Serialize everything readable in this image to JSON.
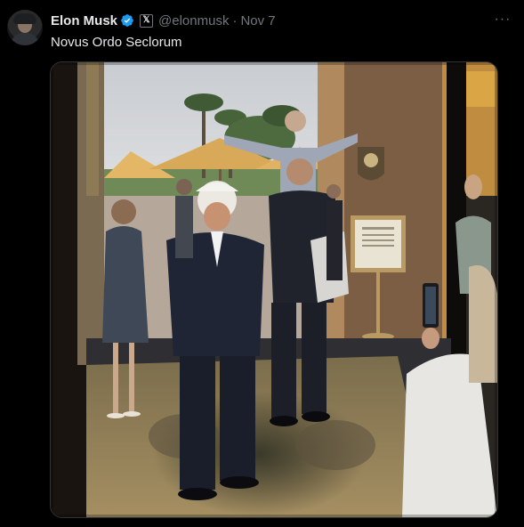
{
  "post": {
    "author": {
      "display_name": "Elon Musk",
      "handle": "@elonmusk",
      "verified_icon": "verified-badge-icon",
      "affiliation_icon": "x-logo-icon",
      "affiliation_glyph": "𝕏"
    },
    "separator": "·",
    "date": "Nov 7",
    "more_glyph": "···",
    "text": "Novus Ordo Seclorum",
    "media": {
      "alt": "Photo of people standing in an ornate doorway"
    }
  },
  "colors": {
    "background": "#000000",
    "text_primary": "#e7e9ea",
    "text_secondary": "#71767b",
    "verified_blue": "#1d9bf0",
    "border": "#2f3336"
  }
}
